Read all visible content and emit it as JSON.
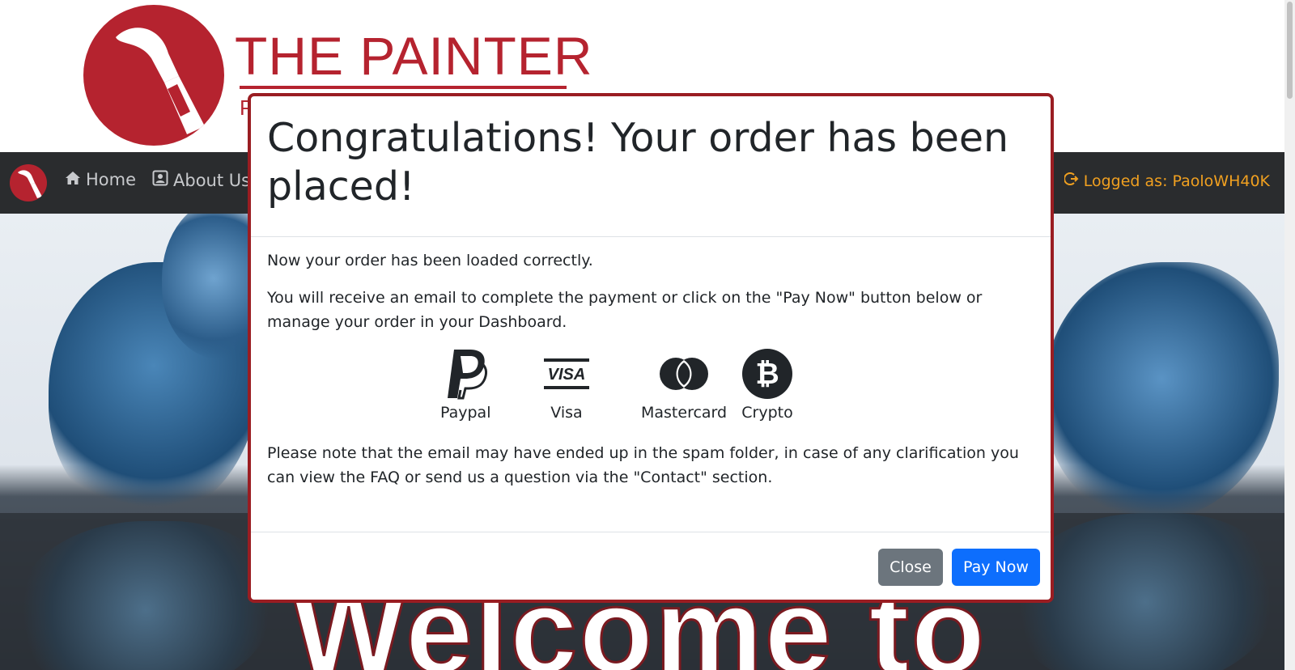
{
  "header": {
    "logo_title": "THE PAINTER",
    "logo_subtitle": "P"
  },
  "navbar": {
    "items": [
      {
        "label": "Home",
        "icon": "home-icon"
      },
      {
        "label": "About Us",
        "icon": "user-card-icon"
      }
    ],
    "user_label": "Logged as: PaoloWH40K",
    "user_icon": "logout-icon"
  },
  "hero": {
    "text": "Welcome to"
  },
  "modal": {
    "title": "Congratulations! Your order has been placed!",
    "body": {
      "p1": "Now your order has been loaded correctly.",
      "p2": "You will receive an email to complete the payment or click on the \"Pay Now\" button below or manage your order in your Dashboard.",
      "payment_methods": [
        {
          "label": "Paypal",
          "icon": "paypal-icon"
        },
        {
          "label": "Visa",
          "icon": "visa-icon"
        },
        {
          "label": "Mastercard",
          "icon": "mastercard-icon"
        },
        {
          "label": "Crypto",
          "icon": "bitcoin-icon"
        }
      ],
      "p3": "Please note that the email may have ended up in the spam folder, in case of any clarification you can view the FAQ or send us a question via the \"Contact\" section."
    },
    "footer": {
      "close_label": "Close",
      "pay_label": "Pay Now"
    }
  },
  "colors": {
    "brand_red": "#b5232f",
    "navbar_bg": "#2a2c2e",
    "user_orange": "#f0a020",
    "primary_blue": "#0d6efd",
    "secondary_gray": "#6c757d",
    "modal_border": "#9a1d22"
  }
}
